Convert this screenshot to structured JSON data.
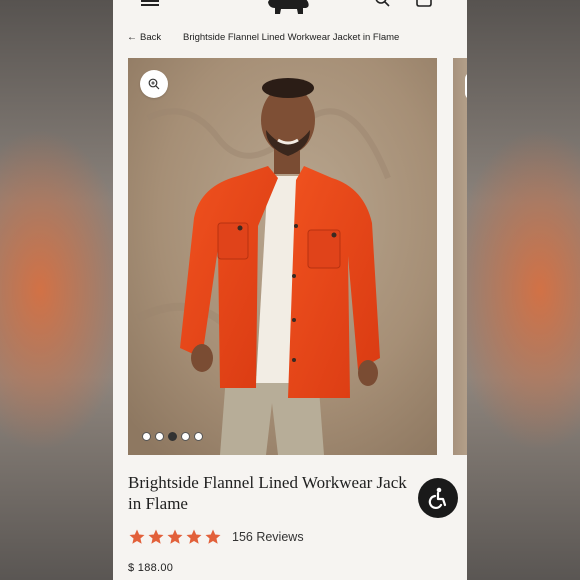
{
  "header": {
    "menu_icon": "hamburger-menu-icon",
    "logo_icon": "bear-logo-icon",
    "search_icon": "search-icon",
    "cart_icon": "cart-icon"
  },
  "breadcrumb": {
    "back_label": "Back",
    "current": "Brightside Flannel Lined Workwear Jacket in Flame"
  },
  "gallery": {
    "zoom_icon": "zoom-in-icon",
    "slide_count": 5,
    "active_slide": 3,
    "image": "man wearing orange flannel workwear jacket over white tee"
  },
  "product": {
    "title": "Brightside Flannel Lined Workwear Jack\nin Flame",
    "rating": 5,
    "reviews": "156 Reviews",
    "price": "$ 188.00"
  },
  "colors": {
    "star": "#e2603a",
    "jacket": "#e5441b",
    "background": "#f6f4f1"
  },
  "accessibility_icon": "accessibility-icon"
}
